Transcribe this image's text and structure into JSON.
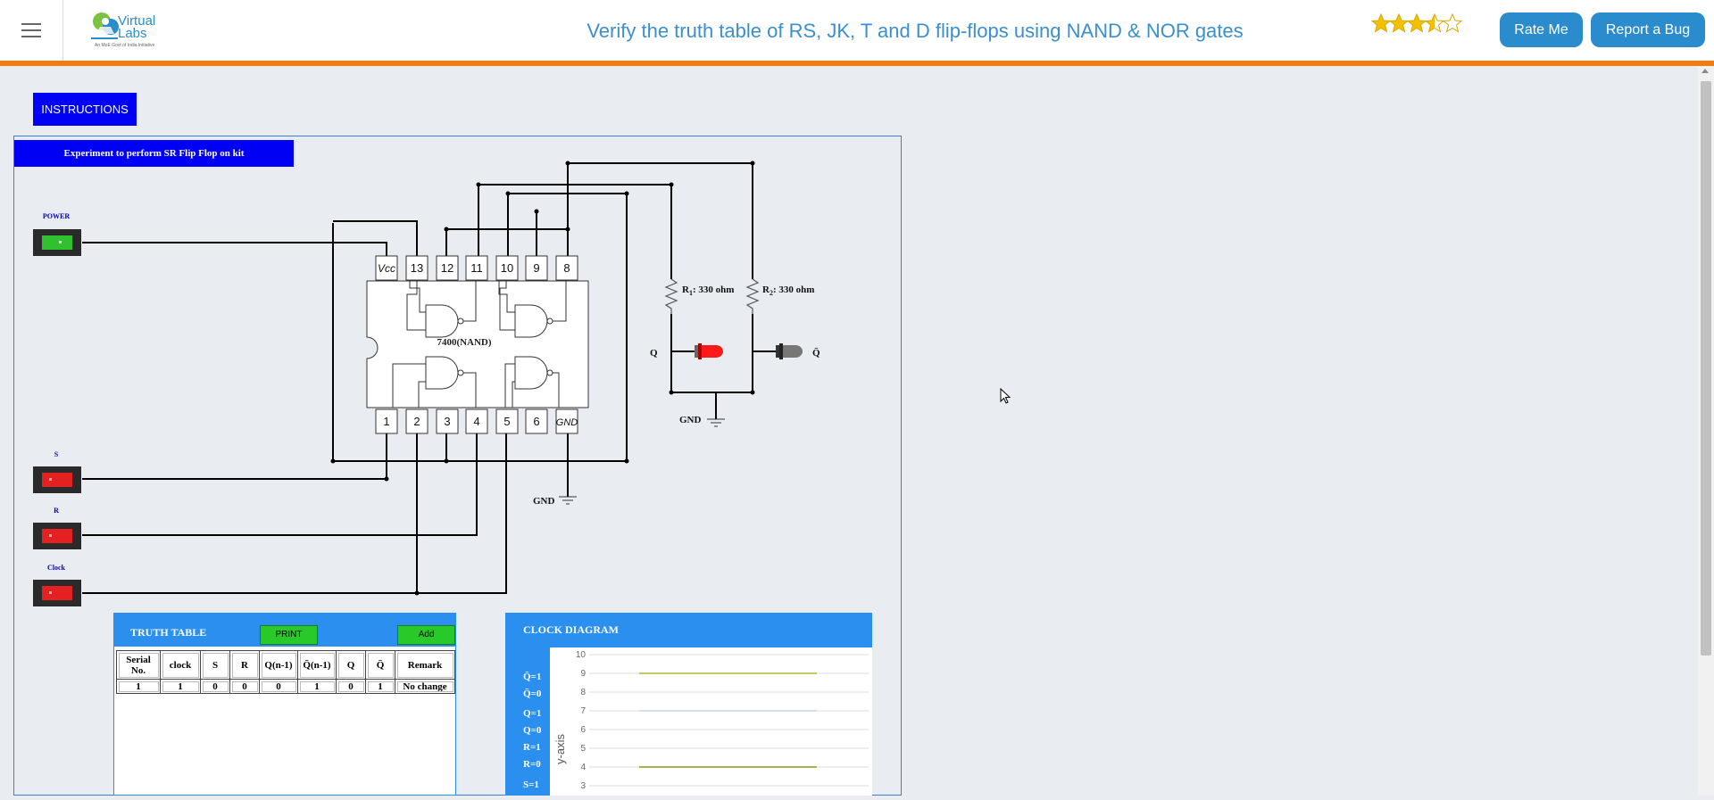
{
  "header": {
    "menu_icon": "hamburger-icon",
    "logo_text": "Virtual Labs",
    "logo_subtitle": "An MoE Govt of India Initiative",
    "title": "Verify the truth table of RS, JK, T and D flip-flops using NAND & NOR gates",
    "rating_stars": "★★★★☆",
    "rating_value": 3.5,
    "rate_label": "Rate Me",
    "bug_label": "Report a Bug",
    "accent": "#f07c14",
    "button_color": "#2b8ccd"
  },
  "main": {
    "instructions_label": "INSTRUCTIONS",
    "experiment_label": "Experiment to perform SR Flip Flop on kit",
    "switches": {
      "power": "POWER",
      "s": "S",
      "r": "R",
      "clock": "Clock"
    },
    "power_state": "on",
    "chip": {
      "name": "7400(NAND)",
      "top_pins": [
        "Vcc",
        "13",
        "12",
        "11",
        "10",
        "9",
        "8"
      ],
      "bottom_pins": [
        "1",
        "2",
        "3",
        "4",
        "5",
        "6",
        "GND"
      ]
    },
    "gnd_chip": "GND",
    "gnd_led": "GND",
    "r1_prefix": "R",
    "r1_sub": "1",
    "r1_value": ": 330 ohm",
    "r2_prefix": "R",
    "r2_sub": "2",
    "r2_value": ": 330 ohm",
    "led_q": "Q",
    "led_qbar": "Q̄",
    "led_q_color": "#ff1a1a",
    "led_qbar_color": "#444444"
  },
  "truth_table": {
    "title": "TRUTH TABLE",
    "print_label": "PRINT",
    "add_label": "Add",
    "headers": [
      "Serial No.",
      "clock",
      "S",
      "R",
      "Q(n-1)",
      "Q̄(n-1)",
      "Q",
      "Q̄",
      "Remark"
    ],
    "rows": [
      [
        "1",
        "1",
        "0",
        "0",
        "0",
        "1",
        "0",
        "1",
        "No change"
      ]
    ]
  },
  "clock_diagram": {
    "title": "CLOCK DIAGRAM",
    "ylabel": "y-axis",
    "yticks": [
      "10",
      "9",
      "8",
      "7",
      "6",
      "5",
      "4",
      "3"
    ],
    "row_labels": [
      "Q̄=1",
      "Q̄=0",
      "Q=1",
      "Q=0",
      "R=1",
      "R=0",
      "S=1"
    ]
  }
}
